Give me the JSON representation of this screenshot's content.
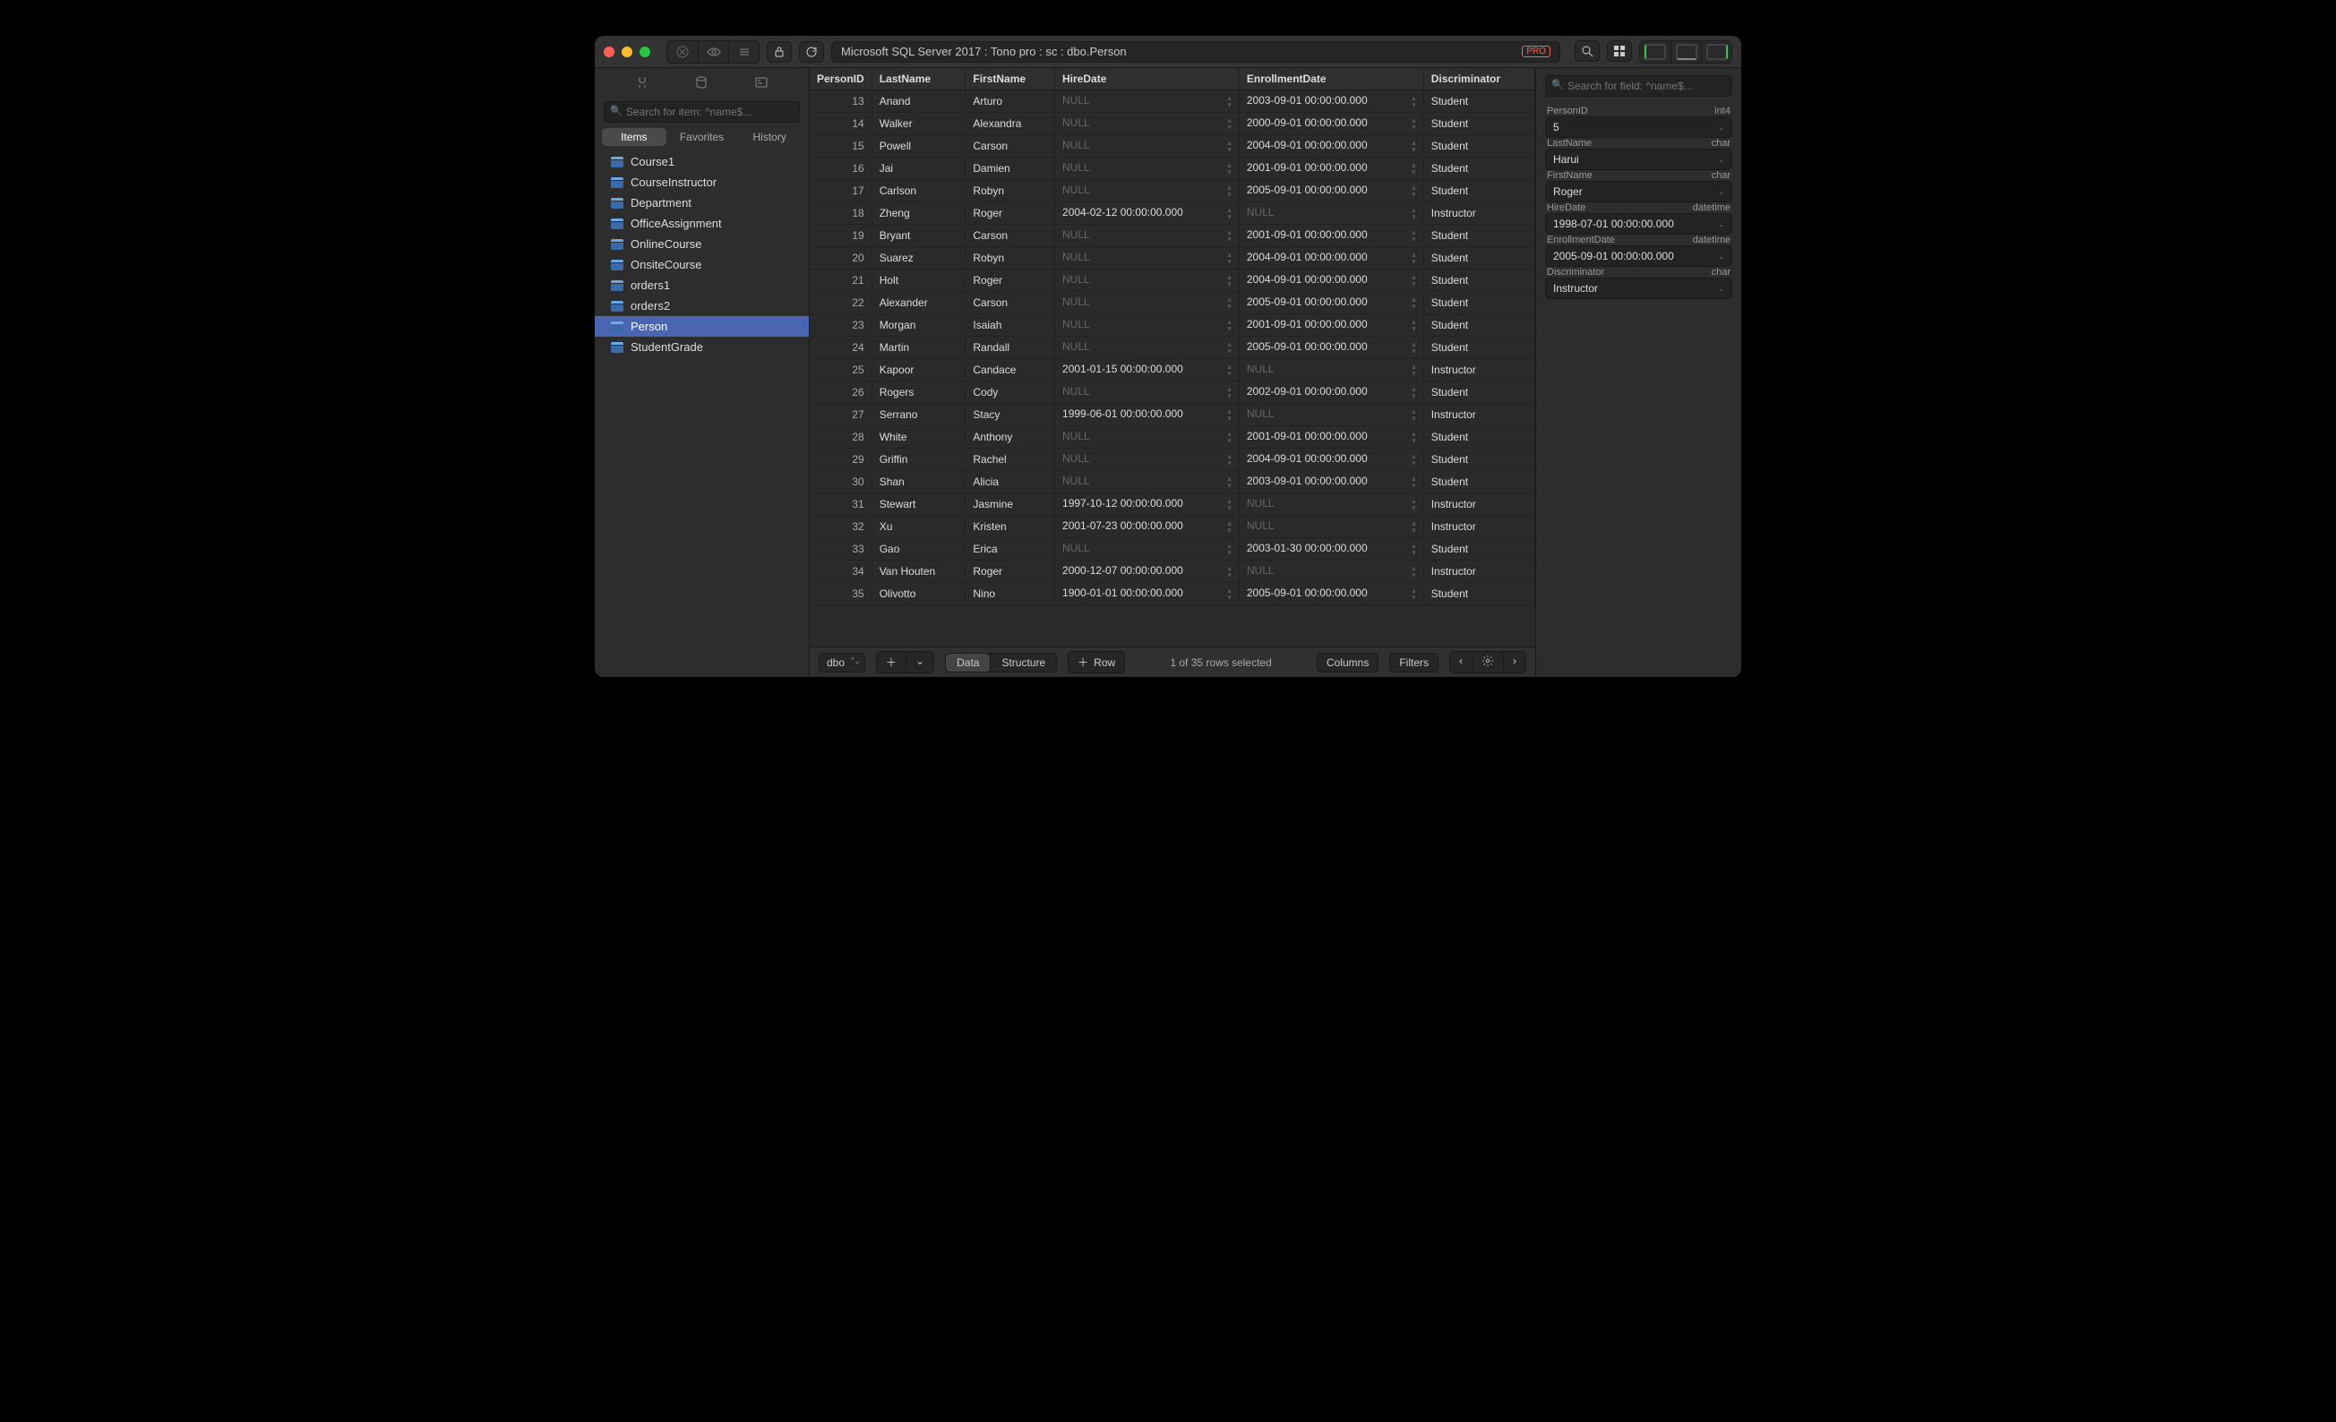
{
  "titlebar": {
    "path": "Microsoft SQL Server 2017 : Tono pro : sc : dbo.Person",
    "pro_badge": "PRO"
  },
  "sidebar": {
    "search_placeholder": "Search for item: ^name$...",
    "tabs": {
      "items": "Items",
      "favorites": "Favorites",
      "history": "History"
    },
    "tables": [
      "Course1",
      "CourseInstructor",
      "Department",
      "OfficeAssignment",
      "OnlineCourse",
      "OnsiteCourse",
      "orders1",
      "orders2",
      "Person",
      "StudentGrade"
    ],
    "selected": "Person"
  },
  "columns": [
    "PersonID",
    "LastName",
    "FirstName",
    "HireDate",
    "EnrollmentDate",
    "Discriminator"
  ],
  "rows": [
    {
      "PersonID": 13,
      "LastName": "Anand",
      "FirstName": "Arturo",
      "HireDate": null,
      "EnrollmentDate": "2003-09-01 00:00:00.000",
      "Discriminator": "Student"
    },
    {
      "PersonID": 14,
      "LastName": "Walker",
      "FirstName": "Alexandra",
      "HireDate": null,
      "EnrollmentDate": "2000-09-01 00:00:00.000",
      "Discriminator": "Student"
    },
    {
      "PersonID": 15,
      "LastName": "Powell",
      "FirstName": "Carson",
      "HireDate": null,
      "EnrollmentDate": "2004-09-01 00:00:00.000",
      "Discriminator": "Student"
    },
    {
      "PersonID": 16,
      "LastName": "Jai",
      "FirstName": "Damien",
      "HireDate": null,
      "EnrollmentDate": "2001-09-01 00:00:00.000",
      "Discriminator": "Student"
    },
    {
      "PersonID": 17,
      "LastName": "Carlson",
      "FirstName": "Robyn",
      "HireDate": null,
      "EnrollmentDate": "2005-09-01 00:00:00.000",
      "Discriminator": "Student"
    },
    {
      "PersonID": 18,
      "LastName": "Zheng",
      "FirstName": "Roger",
      "HireDate": "2004-02-12 00:00:00.000",
      "EnrollmentDate": null,
      "Discriminator": "Instructor"
    },
    {
      "PersonID": 19,
      "LastName": "Bryant",
      "FirstName": "Carson",
      "HireDate": null,
      "EnrollmentDate": "2001-09-01 00:00:00.000",
      "Discriminator": "Student"
    },
    {
      "PersonID": 20,
      "LastName": "Suarez",
      "FirstName": "Robyn",
      "HireDate": null,
      "EnrollmentDate": "2004-09-01 00:00:00.000",
      "Discriminator": "Student"
    },
    {
      "PersonID": 21,
      "LastName": "Holt",
      "FirstName": "Roger",
      "HireDate": null,
      "EnrollmentDate": "2004-09-01 00:00:00.000",
      "Discriminator": "Student"
    },
    {
      "PersonID": 22,
      "LastName": "Alexander",
      "FirstName": "Carson",
      "HireDate": null,
      "EnrollmentDate": "2005-09-01 00:00:00.000",
      "Discriminator": "Student"
    },
    {
      "PersonID": 23,
      "LastName": "Morgan",
      "FirstName": "Isaiah",
      "HireDate": null,
      "EnrollmentDate": "2001-09-01 00:00:00.000",
      "Discriminator": "Student"
    },
    {
      "PersonID": 24,
      "LastName": "Martin",
      "FirstName": "Randall",
      "HireDate": null,
      "EnrollmentDate": "2005-09-01 00:00:00.000",
      "Discriminator": "Student"
    },
    {
      "PersonID": 25,
      "LastName": "Kapoor",
      "FirstName": "Candace",
      "HireDate": "2001-01-15 00:00:00.000",
      "EnrollmentDate": null,
      "Discriminator": "Instructor"
    },
    {
      "PersonID": 26,
      "LastName": "Rogers",
      "FirstName": "Cody",
      "HireDate": null,
      "EnrollmentDate": "2002-09-01 00:00:00.000",
      "Discriminator": "Student"
    },
    {
      "PersonID": 27,
      "LastName": "Serrano",
      "FirstName": "Stacy",
      "HireDate": "1999-06-01 00:00:00.000",
      "EnrollmentDate": null,
      "Discriminator": "Instructor"
    },
    {
      "PersonID": 28,
      "LastName": "White",
      "FirstName": "Anthony",
      "HireDate": null,
      "EnrollmentDate": "2001-09-01 00:00:00.000",
      "Discriminator": "Student"
    },
    {
      "PersonID": 29,
      "LastName": "Griffin",
      "FirstName": "Rachel",
      "HireDate": null,
      "EnrollmentDate": "2004-09-01 00:00:00.000",
      "Discriminator": "Student"
    },
    {
      "PersonID": 30,
      "LastName": "Shan",
      "FirstName": "Alicia",
      "HireDate": null,
      "EnrollmentDate": "2003-09-01 00:00:00.000",
      "Discriminator": "Student"
    },
    {
      "PersonID": 31,
      "LastName": "Stewart",
      "FirstName": "Jasmine",
      "HireDate": "1997-10-12 00:00:00.000",
      "EnrollmentDate": null,
      "Discriminator": "Instructor"
    },
    {
      "PersonID": 32,
      "LastName": "Xu",
      "FirstName": "Kristen",
      "HireDate": "2001-07-23 00:00:00.000",
      "EnrollmentDate": null,
      "Discriminator": "Instructor"
    },
    {
      "PersonID": 33,
      "LastName": "Gao",
      "FirstName": "Erica",
      "HireDate": null,
      "EnrollmentDate": "2003-01-30 00:00:00.000",
      "Discriminator": "Student"
    },
    {
      "PersonID": 34,
      "LastName": "Van Houten",
      "FirstName": "Roger",
      "HireDate": "2000-12-07 00:00:00.000",
      "EnrollmentDate": null,
      "Discriminator": "Instructor"
    },
    {
      "PersonID": 35,
      "LastName": "Olivotto",
      "FirstName": "Nino",
      "HireDate": "1900-01-01 00:00:00.000",
      "EnrollmentDate": "2005-09-01 00:00:00.000",
      "Discriminator": "Student"
    }
  ],
  "null_label": "NULL",
  "footer": {
    "schema": "dbo",
    "data": "Data",
    "structure": "Structure",
    "row": "Row",
    "status": "1 of 35 rows selected",
    "columns": "Columns",
    "filters": "Filters"
  },
  "inspector": {
    "search_placeholder": "Search for field: ^name$...",
    "fields": [
      {
        "name": "PersonID",
        "type": "int4",
        "value": "5"
      },
      {
        "name": "LastName",
        "type": "char",
        "value": "Harui"
      },
      {
        "name": "FirstName",
        "type": "char",
        "value": "Roger"
      },
      {
        "name": "HireDate",
        "type": "datetime",
        "value": "1998-07-01 00:00:00.000"
      },
      {
        "name": "EnrollmentDate",
        "type": "datetime",
        "value": "2005-09-01 00:00:00.000"
      },
      {
        "name": "Discriminator",
        "type": "char",
        "value": "Instructor"
      }
    ]
  }
}
